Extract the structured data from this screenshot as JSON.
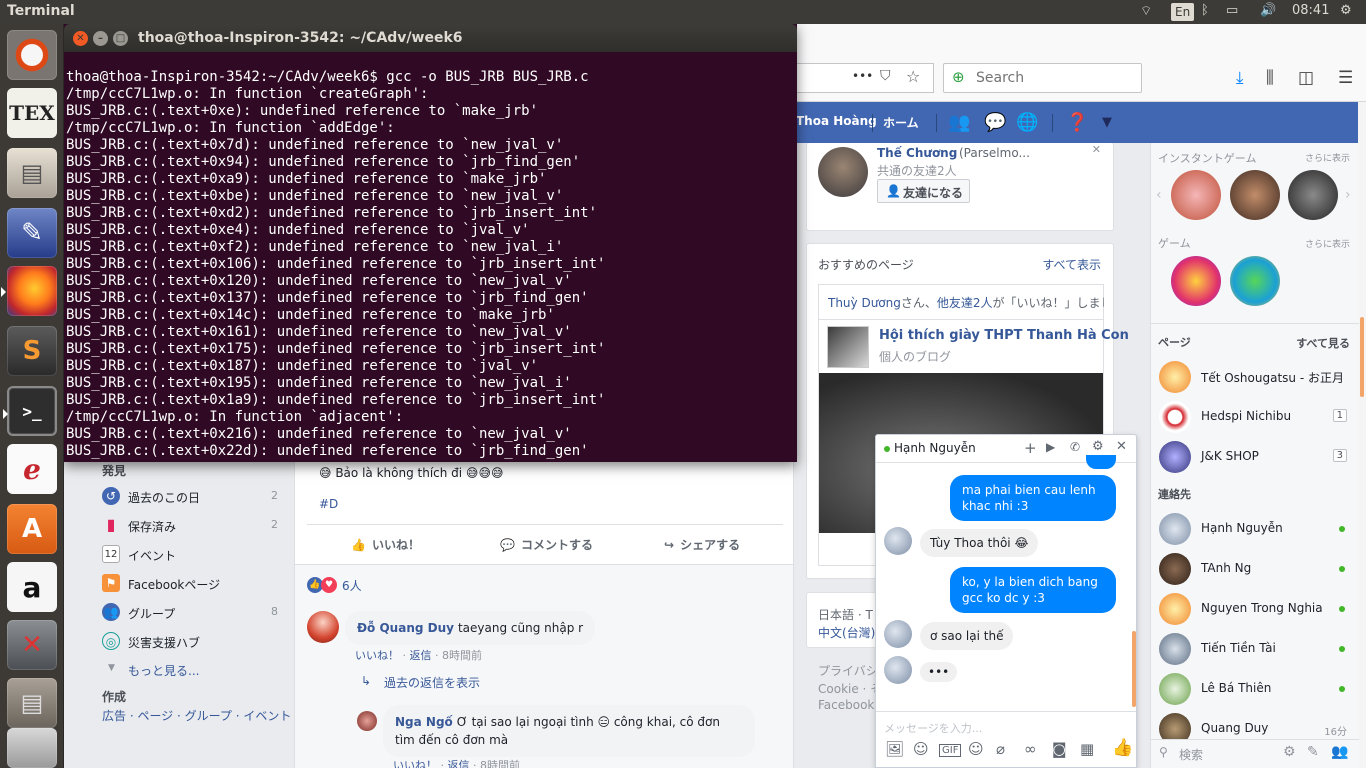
{
  "panel": {
    "title": "Terminal",
    "lang": "En",
    "time": "08:41"
  },
  "terminal": {
    "title": "thoa@thoa-Inspiron-3542: ~/CAdv/week6",
    "lines": [
      "thoa@thoa-Inspiron-3542:~/CAdv/week6$ gcc -o BUS_JRB BUS_JRB.c",
      "/tmp/ccC7L1wp.o: In function `createGraph':",
      "BUS_JRB.c:(.text+0xe): undefined reference to `make_jrb'",
      "/tmp/ccC7L1wp.o: In function `addEdge':",
      "BUS_JRB.c:(.text+0x7d): undefined reference to `new_jval_v'",
      "BUS_JRB.c:(.text+0x94): undefined reference to `jrb_find_gen'",
      "BUS_JRB.c:(.text+0xa9): undefined reference to `make_jrb'",
      "BUS_JRB.c:(.text+0xbe): undefined reference to `new_jval_v'",
      "BUS_JRB.c:(.text+0xd2): undefined reference to `jrb_insert_int'",
      "BUS_JRB.c:(.text+0xe4): undefined reference to `jval_v'",
      "BUS_JRB.c:(.text+0xf2): undefined reference to `new_jval_i'",
      "BUS_JRB.c:(.text+0x106): undefined reference to `jrb_insert_int'",
      "BUS_JRB.c:(.text+0x120): undefined reference to `new_jval_v'",
      "BUS_JRB.c:(.text+0x137): undefined reference to `jrb_find_gen'",
      "BUS_JRB.c:(.text+0x14c): undefined reference to `make_jrb'",
      "BUS_JRB.c:(.text+0x161): undefined reference to `new_jval_v'",
      "BUS_JRB.c:(.text+0x175): undefined reference to `jrb_insert_int'",
      "BUS_JRB.c:(.text+0x187): undefined reference to `jval_v'",
      "BUS_JRB.c:(.text+0x195): undefined reference to `new_jval_i'",
      "BUS_JRB.c:(.text+0x1a9): undefined reference to `jrb_insert_int'",
      "/tmp/ccC7L1wp.o: In function `adjacent':",
      "BUS_JRB.c:(.text+0x216): undefined reference to `new_jval_v'",
      "BUS_JRB.c:(.text+0x22d): undefined reference to `jrb_find_gen'"
    ]
  },
  "firefox": {
    "search_placeholder": "Search",
    "dots": "•••"
  },
  "fb_bar": {
    "user": "Thoa Hoàng",
    "home": "ホーム"
  },
  "friend_suggest": {
    "name": "Thế Chương",
    "alias": "(Parselmo...",
    "mutual": "共通の友達2人",
    "add": "友達になる"
  },
  "rec_pages": {
    "title": "おすすめのページ",
    "see_all": "すべて表示",
    "liked_by_name": "Thuỳ Dương",
    "liked_by_mid": "さん、",
    "liked_by_others": "他友達2人",
    "liked_by_end": "が「いいね！」しました。",
    "page_name": "Hội thích giày THPT Thanh Hà Con",
    "page_type": "個人のブログ"
  },
  "lang_card": {
    "l1": "日本語 · T",
    "l2": "中文(台灣)"
  },
  "footer": {
    "f1": "プライバシ",
    "f2": "Cookie · そ",
    "f3": "Facebook"
  },
  "left_nav": {
    "discover": "発見",
    "items": [
      {
        "label": "過去のこの日",
        "count": "2"
      },
      {
        "label": "保存済み",
        "count": "2"
      },
      {
        "label": "イベント",
        "count": "",
        "icon_text": "12"
      },
      {
        "label": "Facebookページ",
        "count": ""
      },
      {
        "label": "グループ",
        "count": "8"
      },
      {
        "label": "災害支援ハブ",
        "count": ""
      }
    ],
    "more": "もっと見る...",
    "create": "作成",
    "create_links": "広告 · ページ · グループ · イベント"
  },
  "post": {
    "text1": "😅 Bảo là không thích đi 😅😅😅",
    "hashtag": "#D",
    "like": "いいね！",
    "comment": "コメントする",
    "share": "シェアする",
    "reactions": "6人",
    "comments": [
      {
        "author": "Đỗ Quang Duy",
        "text": "taeyang cũng nhập r",
        "like": "いいね！",
        "reply": "返信",
        "time": "8時間前"
      },
      {
        "author": "Nga Ngố",
        "text": "Ơ tại sao lại ngoại tình 😑 công khai, cô đơn tìm đến cô đơn mà",
        "like": "いいね！",
        "reply": "返信",
        "time": "8時間前"
      }
    ],
    "view_replies": "過去の返信を表示"
  },
  "right": {
    "instant_games": "インスタントゲーム",
    "games": "ゲーム",
    "more": "さらに表示",
    "pages_title": "ページ",
    "pages_all": "すべて見る",
    "pages": [
      {
        "name": "Tết Oshougatsu - お正月",
        "badge": ""
      },
      {
        "name": "Hedspi Nichibu",
        "badge": "1"
      },
      {
        "name": "J&K SHOP",
        "badge": "3"
      }
    ],
    "contacts_title": "連絡先",
    "contacts": [
      {
        "name": "Hạnh Nguyễn",
        "status": ""
      },
      {
        "name": "TAnh Ng",
        "status": ""
      },
      {
        "name": "Nguyen Trong Nghia",
        "status": ""
      },
      {
        "name": "Tiến Tiền Tài",
        "status": ""
      },
      {
        "name": "Lê Bá Thiên",
        "status": ""
      },
      {
        "name": "Quang Duy",
        "status": "16分"
      }
    ],
    "search_placeholder": "検索",
    "colors": {
      "online": "#42b72a"
    }
  },
  "chat": {
    "name": "Hạnh Nguyễn",
    "messages": [
      {
        "dir": "out",
        "text": "ma phai bien cau lenh khac nhi :3"
      },
      {
        "dir": "in",
        "text": "Tùy Thoa thôi 😂"
      },
      {
        "dir": "out",
        "text": "ko, y la bien dich bang gcc ko dc y :3"
      },
      {
        "dir": "in",
        "text": "ơ sao lại thế"
      },
      {
        "dir": "in",
        "text": "•••"
      }
    ],
    "input_placeholder": "メッセージを入力..."
  },
  "colors": {
    "fb_blue": "#4267b2",
    "terminal_bg": "#300a24",
    "messenger_blue": "#0084ff"
  }
}
